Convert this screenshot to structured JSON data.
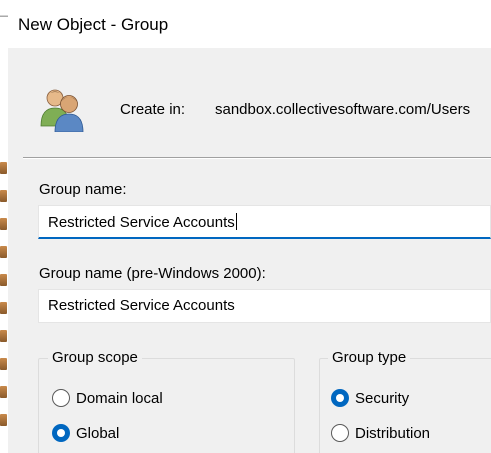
{
  "window": {
    "title": "New Object - Group"
  },
  "header": {
    "icon": "users-group-icon",
    "create_in_label": "Create in:",
    "create_in_path": "sandbox.collectivesoftware.com/Users"
  },
  "group_name": {
    "label": "Group name:",
    "value": "Restricted Service Accounts"
  },
  "group_name_pre2000": {
    "label": "Group name (pre-Windows 2000):",
    "value": "Restricted Service Accounts"
  },
  "group_scope": {
    "title": "Group scope",
    "options": [
      {
        "label": "Domain local",
        "checked": false
      },
      {
        "label": "Global",
        "checked": true
      }
    ]
  },
  "group_type": {
    "title": "Group type",
    "options": [
      {
        "label": "Security",
        "checked": true
      },
      {
        "label": "Distribution",
        "checked": false
      }
    ]
  },
  "colors": {
    "accent": "#0067c0",
    "dialog_bg": "#f0f0f0",
    "title_bg": "#ffffff"
  }
}
